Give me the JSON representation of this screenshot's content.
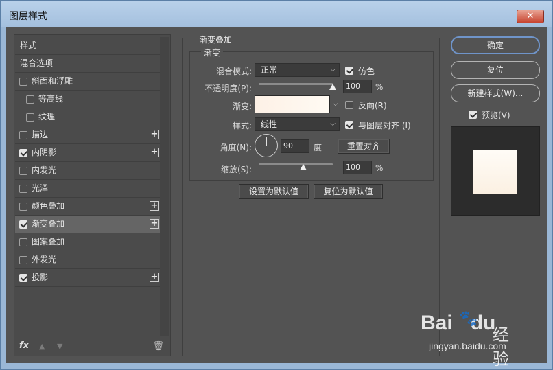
{
  "window": {
    "title": "图层样式",
    "close_glyph": "✕"
  },
  "left_list": {
    "items": [
      {
        "label": "样式",
        "checkbox": false,
        "checked": false,
        "plus": false,
        "indent": false,
        "active": false
      },
      {
        "label": "混合选项",
        "checkbox": false,
        "checked": false,
        "plus": false,
        "indent": false,
        "active": false
      },
      {
        "label": "斜面和浮雕",
        "checkbox": true,
        "checked": false,
        "plus": false,
        "indent": false,
        "active": false
      },
      {
        "label": "等高线",
        "checkbox": true,
        "checked": false,
        "plus": false,
        "indent": true,
        "active": false
      },
      {
        "label": "纹理",
        "checkbox": true,
        "checked": false,
        "plus": false,
        "indent": true,
        "active": false
      },
      {
        "label": "描边",
        "checkbox": true,
        "checked": false,
        "plus": true,
        "indent": false,
        "active": false
      },
      {
        "label": "内阴影",
        "checkbox": true,
        "checked": true,
        "plus": true,
        "indent": false,
        "active": false
      },
      {
        "label": "内发光",
        "checkbox": true,
        "checked": false,
        "plus": false,
        "indent": false,
        "active": false
      },
      {
        "label": "光泽",
        "checkbox": true,
        "checked": false,
        "plus": false,
        "indent": false,
        "active": false
      },
      {
        "label": "颜色叠加",
        "checkbox": true,
        "checked": false,
        "plus": true,
        "indent": false,
        "active": false
      },
      {
        "label": "渐变叠加",
        "checkbox": true,
        "checked": true,
        "plus": true,
        "indent": false,
        "active": true
      },
      {
        "label": "图案叠加",
        "checkbox": true,
        "checked": false,
        "plus": false,
        "indent": false,
        "active": false
      },
      {
        "label": "外发光",
        "checkbox": true,
        "checked": false,
        "plus": false,
        "indent": false,
        "active": false
      },
      {
        "label": "投影",
        "checkbox": true,
        "checked": true,
        "plus": true,
        "indent": false,
        "active": false
      }
    ],
    "bottom": {
      "fx": "fx",
      "up_glyph": "▲",
      "down_glyph": "▼",
      "trash_glyph": "🗑"
    }
  },
  "gradient_overlay": {
    "group_title": "渐变叠加",
    "sub_title": "渐变",
    "blend_mode_label": "混合模式:",
    "blend_mode_value": "正常",
    "dither_label": "仿色",
    "opacity_label": "不透明度(P):",
    "opacity_value": "100",
    "opacity_percent": 100,
    "percent_unit": "%",
    "gradient_label": "渐变:",
    "reverse_label": "反向(R)",
    "style_label": "样式:",
    "style_value": "线性",
    "align_label": "与图层对齐 (I)",
    "angle_label": "角度(N):",
    "angle_value": "90",
    "angle_unit": "度",
    "reset_align_button": "重置对齐",
    "scale_label": "缩放(S):",
    "scale_value": "100",
    "scale_percent": 100,
    "set_default_button": "设置为默认值",
    "reset_default_button": "复位为默认值",
    "dither_checked": true,
    "reverse_checked": false,
    "align_checked": true
  },
  "right_panel": {
    "ok_button": "确定",
    "reset_button": "复位",
    "new_style_button": "新建样式(W)...",
    "preview_label": "预览(V)",
    "preview_checked": true
  },
  "watermark": {
    "logo": "Bai",
    "logo_tail": "du",
    "cn": "经验",
    "url": "jingyan.baidu.com"
  }
}
